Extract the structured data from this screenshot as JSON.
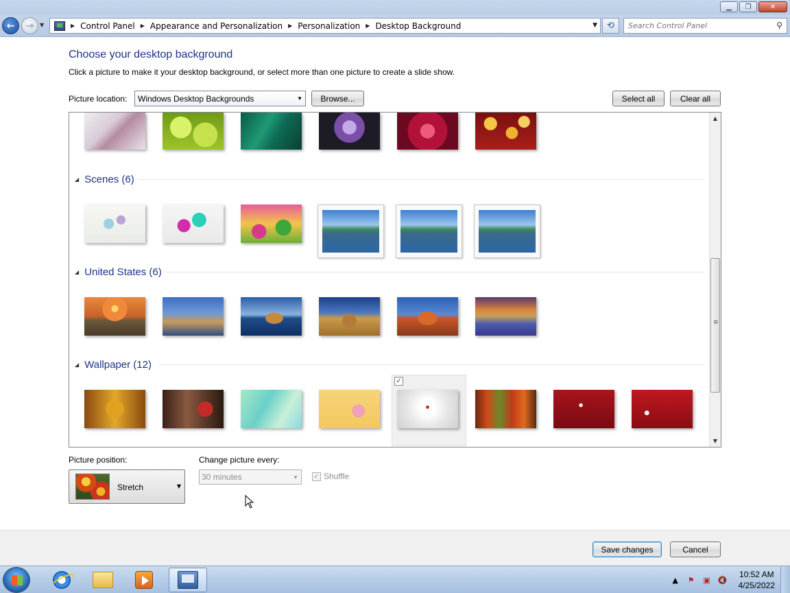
{
  "window": {
    "minimize_icon": "minimize-icon",
    "restore_icon": "restore-icon",
    "close_icon": "close-icon"
  },
  "nav": {
    "breadcrumbs": [
      "Control Panel",
      "Appearance and Personalization",
      "Personalization",
      "Desktop Background"
    ],
    "search_placeholder": "Search Control Panel"
  },
  "page": {
    "heading": "Choose your desktop background",
    "subtext": "Click a picture to make it your desktop background, or select more than one picture to create a slide show.",
    "location_label": "Picture location:",
    "location_value": "Windows Desktop Backgrounds",
    "browse_label": "Browse...",
    "select_all_label": "Select all",
    "clear_all_label": "Clear all"
  },
  "groups": [
    {
      "name": "Scenes (6)"
    },
    {
      "name": "United States (6)"
    },
    {
      "name": "Wallpaper (12)"
    }
  ],
  "options": {
    "position_label": "Picture position:",
    "position_value": "Stretch",
    "change_label": "Change picture every:",
    "change_value": "30 minutes",
    "shuffle_label": "Shuffle",
    "shuffle_checked": true
  },
  "footer": {
    "save_label": "Save changes",
    "cancel_label": "Cancel"
  },
  "taskbar": {
    "time": "10:52 AM",
    "date": "4/25/2022"
  }
}
